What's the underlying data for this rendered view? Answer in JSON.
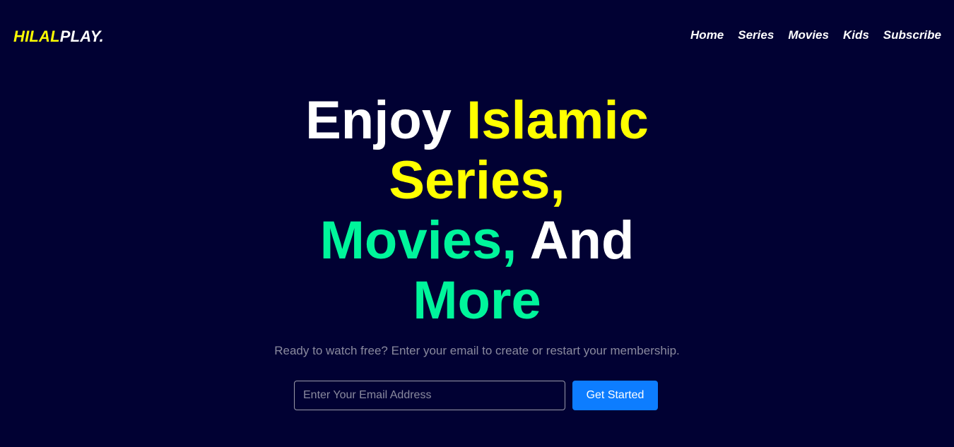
{
  "header": {
    "logo_part1": "HILAL",
    "logo_part2": "PLAY.",
    "nav": [
      "Home",
      "Series",
      "Movies",
      "Kids",
      "Subscribe"
    ]
  },
  "hero": {
    "headline": {
      "enjoy": "Enjoy",
      "islamic": "Islamic",
      "series": "Series,",
      "movies": "Movies,",
      "and": "And",
      "more": "More"
    },
    "subtitle": "Ready to watch free? Enter your email to create or restart your membership.",
    "email_placeholder": "Enter Your Email Address",
    "cta_label": "Get Started"
  },
  "colors": {
    "background": "#010133",
    "accent_yellow": "#ffff00",
    "accent_green": "#00f59b",
    "button_blue": "#0d7dff"
  }
}
